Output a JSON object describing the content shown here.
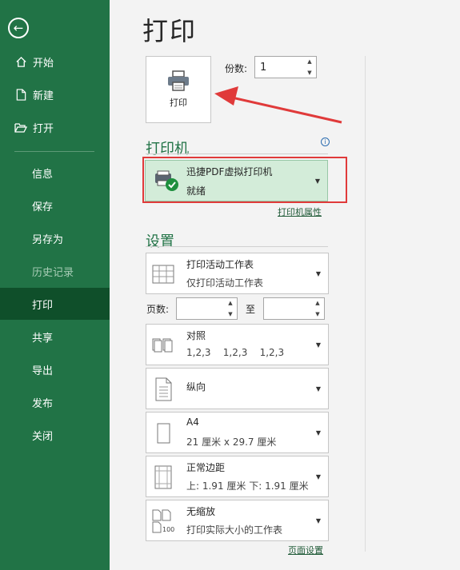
{
  "sidebar": {
    "items": [
      {
        "label": "开始",
        "icon": "home-icon"
      },
      {
        "label": "新建",
        "icon": "new-document-icon"
      },
      {
        "label": "打开",
        "icon": "open-folder-icon"
      },
      {
        "label": "信息"
      },
      {
        "label": "保存"
      },
      {
        "label": "另存为"
      },
      {
        "label": "历史记录",
        "disabled": true
      },
      {
        "label": "打印",
        "active": true
      },
      {
        "label": "共享"
      },
      {
        "label": "导出"
      },
      {
        "label": "发布"
      },
      {
        "label": "关闭"
      }
    ]
  },
  "main": {
    "title": "打印",
    "print_button_label": "打印",
    "copies_label": "份数:",
    "copies_value": "1",
    "printer_heading": "打印机",
    "printer": {
      "name": "迅捷PDF虚拟打印机",
      "status": "就绪"
    },
    "printer_properties_link": "打印机属性",
    "settings_heading": "设置",
    "settings": [
      {
        "line1": "打印活动工作表",
        "line2": "仅打印活动工作表"
      },
      {
        "line1": "对照",
        "line2": "1,2,3    1,2,3    1,2,3"
      },
      {
        "line1": "纵向",
        "line2": ""
      },
      {
        "line1": "A4",
        "line2": "21 厘米 x 29.7 厘米"
      },
      {
        "line1": "正常边距",
        "line2": "上: 1.91 厘米 下: 1.91 厘米"
      },
      {
        "line1": "无缩放",
        "line2": "打印实际大小的工作表"
      }
    ],
    "pages_label": "页数:",
    "to_label": "至",
    "page_setup_link": "页面设置"
  },
  "colors": {
    "sidebar_bg": "#217346",
    "sidebar_active": "#0f4f2a",
    "accent": "#217346",
    "printer_selected_bg": "#d3ecd9",
    "annotation_red": "#e03a3a"
  }
}
